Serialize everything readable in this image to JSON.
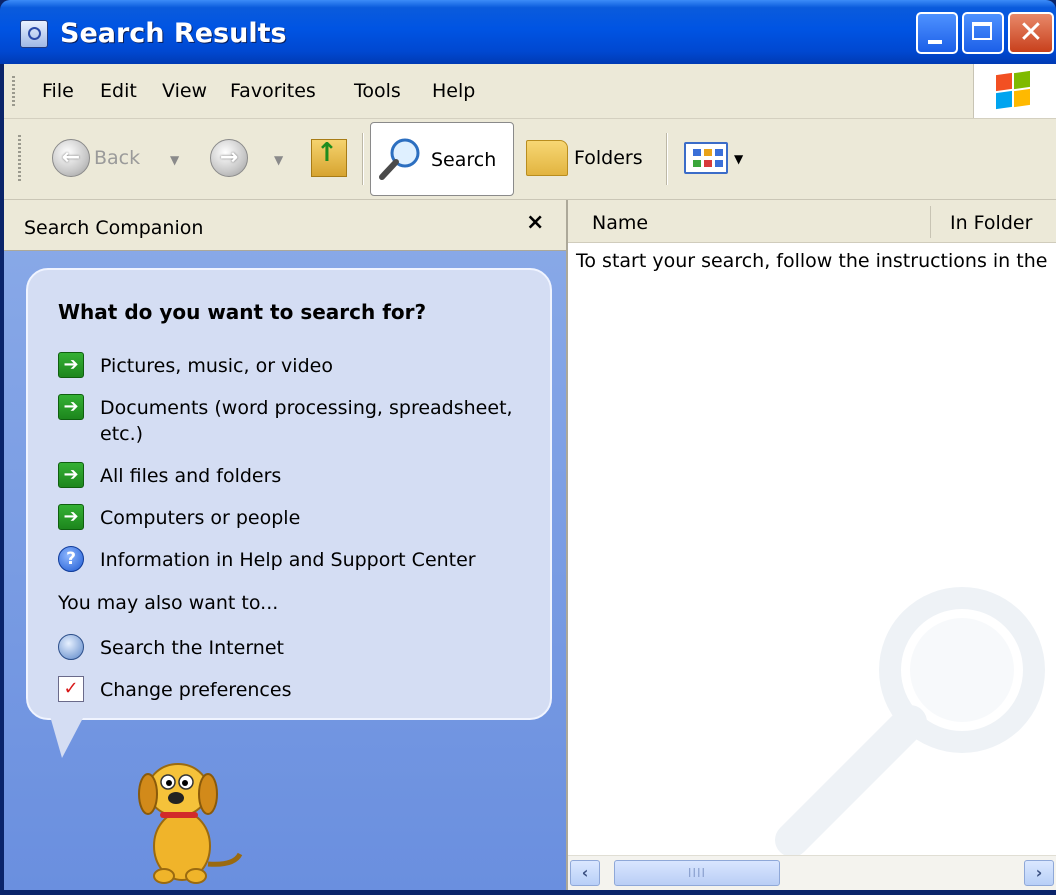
{
  "window": {
    "title": "Search Results"
  },
  "menubar": {
    "items": [
      "File",
      "Edit",
      "View",
      "Favorites",
      "Tools",
      "Help"
    ]
  },
  "toolbar": {
    "back_label": "Back",
    "search_label": "Search",
    "folders_label": "Folders"
  },
  "search_companion": {
    "title": "Search Companion",
    "close_glyph": "×",
    "question": "What do you want to search for?",
    "options": [
      {
        "label": "Pictures, music, or video",
        "icon": "green-arrow-icon"
      },
      {
        "label": "Documents (word processing, spreadsheet, etc.)",
        "icon": "green-arrow-icon"
      },
      {
        "label": "All files and folders",
        "icon": "green-arrow-icon"
      },
      {
        "label": "Computers or people",
        "icon": "green-arrow-icon"
      },
      {
        "label": "Information in Help and Support Center",
        "icon": "help-icon"
      }
    ],
    "also_heading": "You may also want to...",
    "also_options": [
      {
        "label": "Search the Internet",
        "icon": "search-internet-icon"
      },
      {
        "label": "Change preferences",
        "icon": "preferences-icon"
      }
    ]
  },
  "results": {
    "columns": [
      "Name",
      "In Folder"
    ],
    "instruction": "To start your search, follow the instructions in the"
  },
  "colors": {
    "titlebar_blue": "#0054e3",
    "pane_blue": "#6a8fdf",
    "bubble": "#d4ddf3",
    "toolbar_beige": "#ece9d8"
  }
}
